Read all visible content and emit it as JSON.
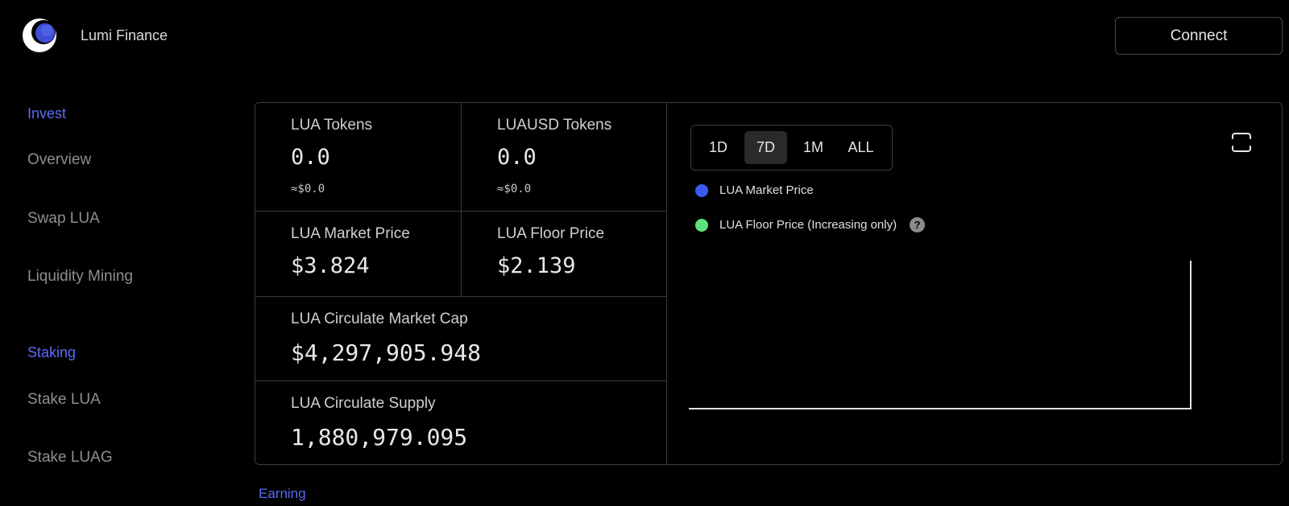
{
  "app": {
    "name": "Lumi Finance"
  },
  "header": {
    "connect_label": "Connect"
  },
  "sidebar": {
    "sections": [
      {
        "title": "Invest",
        "items": [
          "Overview",
          "Swap LUA",
          "Liquidity Mining"
        ]
      },
      {
        "title": "Staking",
        "items": [
          "Stake LUA",
          "Stake LUAG"
        ]
      }
    ]
  },
  "stats": {
    "lua_tokens": {
      "label": "LUA Tokens",
      "value": "0.0",
      "usd": "≈$0.0"
    },
    "luausd_tokens": {
      "label": "LUAUSD Tokens",
      "value": "0.0",
      "usd": "≈$0.0"
    },
    "market_price": {
      "label": "LUA Market Price",
      "value": "$3.824"
    },
    "floor_price": {
      "label": "LUA Floor Price",
      "value": "$2.139"
    },
    "market_cap": {
      "label": "LUA Circulate Market Cap",
      "value": "$4,297,905.948"
    },
    "supply": {
      "label": "LUA Circulate Supply",
      "value": "1,880,979.095"
    }
  },
  "chart": {
    "ranges": [
      "1D",
      "7D",
      "1M",
      "ALL"
    ],
    "selected_range": "7D",
    "legend": [
      {
        "label": "LUA Market Price",
        "color": "#3b5bf0"
      },
      {
        "label": "LUA Floor Price (Increasing only)",
        "color": "#5ee07a"
      }
    ],
    "axis_color": "#e0e0e0"
  },
  "footer_section": {
    "title": "Earning"
  },
  "icons": {
    "logo": "moon-logo-icon",
    "expand": "expand-icon",
    "help": "help-icon"
  }
}
